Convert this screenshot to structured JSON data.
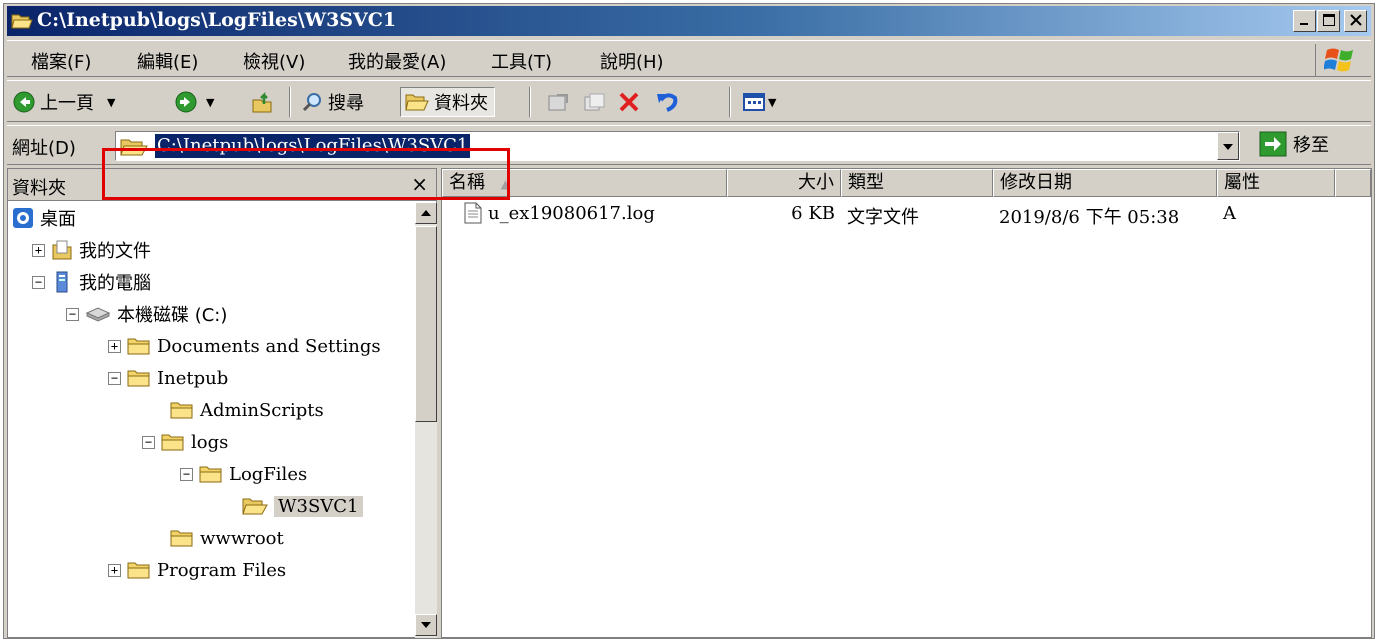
{
  "window": {
    "title": "C:\\Inetpub\\logs\\LogFiles\\W3SVC1",
    "controls": [
      "minimize",
      "maximize",
      "close"
    ]
  },
  "menu": [
    {
      "label": "檔案(F)"
    },
    {
      "label": "編輯(E)"
    },
    {
      "label": "檢視(V)"
    },
    {
      "label": "我的最愛(A)"
    },
    {
      "label": "工具(T)"
    },
    {
      "label": "說明(H)"
    }
  ],
  "toolbar": {
    "back_label": "上一頁",
    "search_label": "搜尋",
    "folders_label": "資料夾"
  },
  "address": {
    "label": "網址(D)",
    "value": "C:\\Inetpub\\logs\\LogFiles\\W3SVC1",
    "go_label": "移至"
  },
  "folders_pane": {
    "title": "資料夾",
    "close_glyph": "×",
    "tree": [
      {
        "label": "桌面",
        "icon": "desktop-icon",
        "expander": ""
      },
      {
        "label": "我的文件",
        "icon": "my-documents-icon",
        "expander": "+"
      },
      {
        "label": "我的電腦",
        "icon": "my-computer-icon",
        "expander": "−"
      },
      {
        "label": "本機磁碟 (C:)",
        "icon": "hard-drive-icon",
        "expander": "−"
      },
      {
        "label": "Documents and Settings",
        "icon": "folder-icon",
        "expander": "+"
      },
      {
        "label": "Inetpub",
        "icon": "folder-icon",
        "expander": "−"
      },
      {
        "label": "AdminScripts",
        "icon": "folder-icon",
        "expander": ""
      },
      {
        "label": "logs",
        "icon": "folder-icon",
        "expander": "−"
      },
      {
        "label": "LogFiles",
        "icon": "folder-icon",
        "expander": "−"
      },
      {
        "label": "W3SVC1",
        "icon": "open-folder-icon",
        "expander": ""
      },
      {
        "label": "wwwroot",
        "icon": "folder-icon",
        "expander": ""
      },
      {
        "label": "Program Files",
        "icon": "folder-icon",
        "expander": "+"
      }
    ]
  },
  "file_list": {
    "columns": [
      "名稱",
      "大小",
      "類型",
      "修改日期",
      "屬性"
    ],
    "sort_indicator": "▲",
    "rows": [
      {
        "name": "u_ex19080617.log",
        "size": "6 KB",
        "type": "文字文件",
        "modified": "2019/8/6 下午 05:38",
        "attributes": "A"
      }
    ]
  },
  "colors": {
    "title_start": "#0a246a",
    "title_end": "#a6caf0",
    "highlight_border": "#e00000",
    "selection": "#0a246a",
    "chrome": "#d4d0c8"
  }
}
